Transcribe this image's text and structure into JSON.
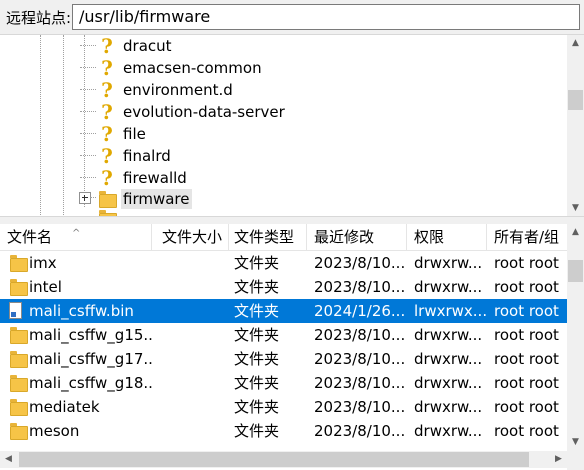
{
  "address": {
    "label": "远程站点:",
    "path": "/usr/lib/firmware"
  },
  "tree": {
    "items": [
      {
        "label": "dracut",
        "icon": "question-icon"
      },
      {
        "label": "emacsen-common",
        "icon": "question-icon"
      },
      {
        "label": "environment.d",
        "icon": "question-icon"
      },
      {
        "label": "evolution-data-server",
        "icon": "question-icon"
      },
      {
        "label": "file",
        "icon": "question-icon"
      },
      {
        "label": "finalrd",
        "icon": "question-icon"
      },
      {
        "label": "firewalld",
        "icon": "question-icon"
      },
      {
        "label": "firmware",
        "icon": "folder-icon"
      }
    ]
  },
  "list": {
    "columns": [
      "文件名",
      "文件大小",
      "文件类型",
      "最近修改",
      "权限",
      "所有者/组"
    ],
    "rows": [
      {
        "name": "imx",
        "size": "",
        "type": "文件夹",
        "modified": "2023/8/10...",
        "perms": "drwxrw...",
        "owner": "root root",
        "icon": "folder-icon",
        "selected": false
      },
      {
        "name": "intel",
        "size": "",
        "type": "文件夹",
        "modified": "2023/8/10...",
        "perms": "drwxrw...",
        "owner": "root root",
        "icon": "folder-icon",
        "selected": false
      },
      {
        "name": "mali_csffw.bin",
        "size": "",
        "type": "文件夹",
        "modified": "2024/1/26...",
        "perms": "lrwxrwx...",
        "owner": "root root",
        "icon": "file-link-icon",
        "selected": true
      },
      {
        "name": "mali_csffw_g15...",
        "size": "",
        "type": "文件夹",
        "modified": "2023/8/10...",
        "perms": "drwxrw...",
        "owner": "root root",
        "icon": "folder-icon",
        "selected": false
      },
      {
        "name": "mali_csffw_g17...",
        "size": "",
        "type": "文件夹",
        "modified": "2023/8/10...",
        "perms": "drwxrw...",
        "owner": "root root",
        "icon": "folder-icon",
        "selected": false
      },
      {
        "name": "mali_csffw_g18...",
        "size": "",
        "type": "文件夹",
        "modified": "2023/8/10...",
        "perms": "drwxrw...",
        "owner": "root root",
        "icon": "folder-icon",
        "selected": false
      },
      {
        "name": "mediatek",
        "size": "",
        "type": "文件夹",
        "modified": "2023/8/10...",
        "perms": "drwxrw...",
        "owner": "root root",
        "icon": "folder-icon",
        "selected": false
      },
      {
        "name": "meson",
        "size": "",
        "type": "文件夹",
        "modified": "2023/8/10...",
        "perms": "drwxrw...",
        "owner": "root root",
        "icon": "folder-icon",
        "selected": false
      }
    ]
  },
  "colors": {
    "selection": "#0078d7",
    "folder": "#f6c447",
    "question": "#e0a800"
  }
}
